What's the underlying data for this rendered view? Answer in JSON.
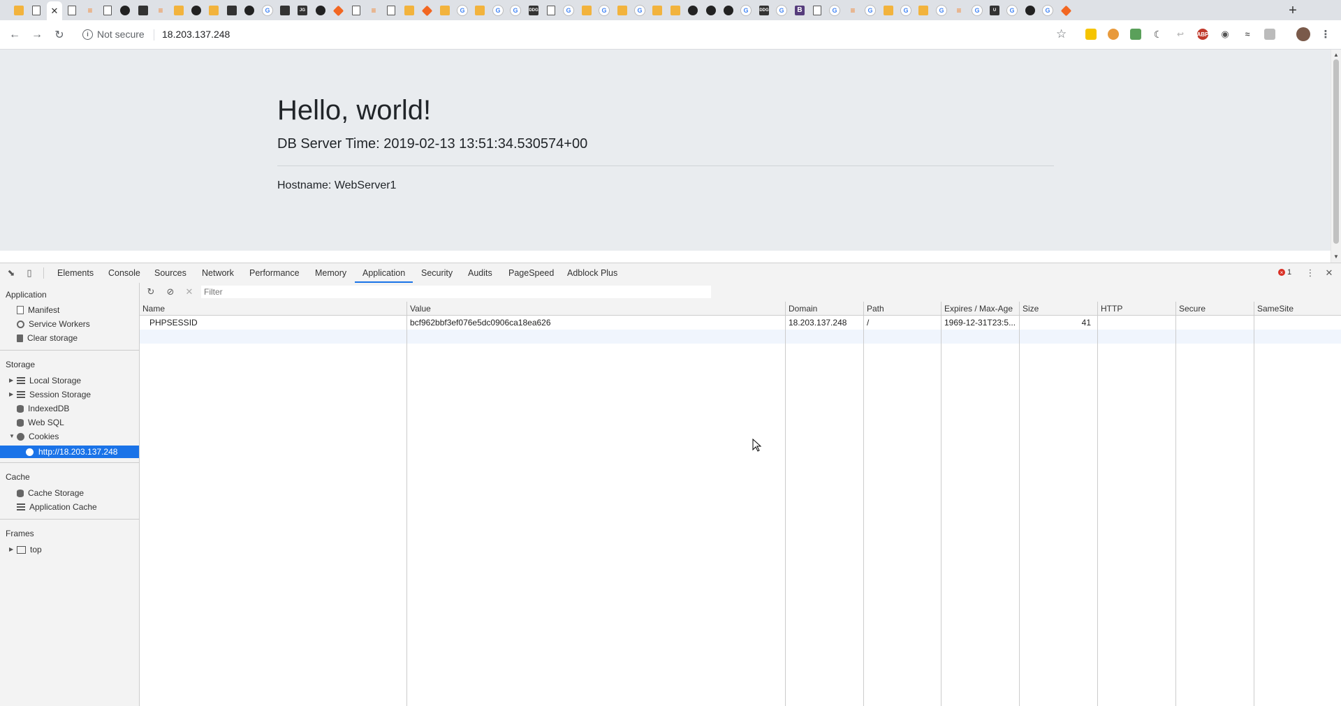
{
  "browser": {
    "security_label": "Not secure",
    "url": "18.203.137.248",
    "tab_icons": [
      "box-icon",
      "doc-icon",
      "close-icon",
      "doc-icon",
      "so-icon",
      "doc-icon",
      "github-icon",
      "puzzle-icon",
      "so-icon",
      "box-icon",
      "github-icon",
      "box-icon",
      "bars-icon",
      "github-icon",
      "google-icon",
      "diamond-icon",
      "jg-icon",
      "github-icon",
      "orange-icon",
      "doc-icon",
      "so-icon",
      "doc-icon",
      "box-icon",
      "orange-icon",
      "box-icon",
      "google-icon",
      "box-icon",
      "google-icon",
      "google-icon",
      "ddg-icon",
      "doc-icon",
      "google-icon",
      "box-icon",
      "google-icon",
      "box-icon",
      "google-icon",
      "box-icon",
      "box-icon",
      "github-icon",
      "github-icon",
      "github-icon",
      "google-icon",
      "ddg-icon",
      "google-icon",
      "bootstrap-icon",
      "doc-icon",
      "google-icon",
      "so-icon",
      "google-icon",
      "box-icon",
      "google-icon",
      "box-icon",
      "google-icon",
      "so-icon",
      "google-icon",
      "ul-icon",
      "google-icon",
      "github-icon",
      "google-icon",
      "orange-icon"
    ],
    "jg_label": "JG",
    "bootstrap_label": "B",
    "ddg_label": "DDG",
    "ul_label": "U"
  },
  "page": {
    "heading": "Hello, world!",
    "db_time": "DB Server Time: 2019-02-13 13:51:34.530574+00",
    "hostname": "Hostname: WebServer1"
  },
  "devtools": {
    "tabs": [
      "Elements",
      "Console",
      "Sources",
      "Network",
      "Performance",
      "Memory",
      "Application",
      "Security",
      "Audits",
      "PageSpeed",
      "Adblock Plus"
    ],
    "selected_tab": "Application",
    "error_count": "1",
    "sidebar": {
      "application_header": "Application",
      "application_items": [
        "Manifest",
        "Service Workers",
        "Clear storage"
      ],
      "storage_header": "Storage",
      "storage_items": [
        "Local Storage",
        "Session Storage",
        "IndexedDB",
        "Web SQL",
        "Cookies"
      ],
      "cookie_origin": "http://18.203.137.248",
      "cache_header": "Cache",
      "cache_items": [
        "Cache Storage",
        "Application Cache"
      ],
      "frames_header": "Frames",
      "frames_items": [
        "top"
      ]
    },
    "filter_placeholder": "Filter",
    "cookie_table": {
      "columns": [
        "Name",
        "Value",
        "Domain",
        "Path",
        "Expires / Max-Age",
        "Size",
        "HTTP",
        "Secure",
        "SameSite"
      ],
      "rows": [
        [
          "PHPSESSID",
          "bcf962bbf3ef076e5dc0906ca18ea626",
          "18.203.137.248",
          "/",
          "1969-12-31T23:5...",
          "41",
          "",
          "",
          ""
        ]
      ]
    }
  }
}
